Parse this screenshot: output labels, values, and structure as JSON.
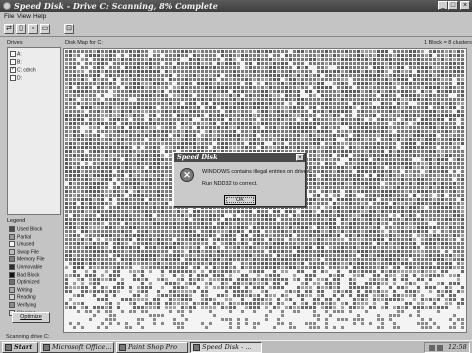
{
  "window": {
    "title": "Speed Disk - Drive C: Scanning, 8% Complete"
  },
  "menu": [
    "File",
    "View",
    "Help"
  ],
  "drives_label": "Drives",
  "drives": [
    {
      "label": "A:",
      "checked": false
    },
    {
      "label": "B:",
      "checked": false
    },
    {
      "label": "C:  cdrch",
      "checked": true
    },
    {
      "label": "D:",
      "checked": false
    }
  ],
  "map_label": "Disk Map for C:",
  "map_scale": "1 Block = 8 clusters",
  "legend": {
    "title": "Legend",
    "items": [
      {
        "label": "Used Block",
        "color": "#4a4a4a"
      },
      {
        "label": "Partial",
        "color": "#9a9a9a"
      },
      {
        "label": "Unused",
        "color": "#f4f4f4"
      },
      {
        "label": "Swap File",
        "color": "#bdbdbd"
      },
      {
        "label": "Memory File",
        "color": "#7e7e7e"
      },
      {
        "label": "Unmovable",
        "color": "#2e2e2e"
      },
      {
        "label": "Bad Block",
        "color": "#111111"
      },
      {
        "label": "Optimized",
        "color": "#6e6e6e"
      },
      {
        "label": "Writing",
        "color": "#a8a8a8"
      },
      {
        "label": "Reading",
        "color": "#d0d0d0"
      },
      {
        "label": "Verifying",
        "color": "#8a8a8a"
      },
      {
        "label": "Clearing",
        "color": "#e0e0e0"
      }
    ]
  },
  "optimize_button": "Optimize",
  "dialog": {
    "title": "Speed Disk",
    "message_line1": "WINDOWS contains illegal entries on drive C",
    "message_line2": "Run NDD32 to correct.",
    "ok": "OK"
  },
  "status": "Scanning drive C:",
  "taskbar": {
    "start": "Start",
    "items": [
      "Microsoft Office...",
      "Paint Shop Pro",
      "Speed Disk - ..."
    ],
    "clock": "12:58"
  },
  "colors": {
    "titlebar": "#4a4a4a",
    "used": "#4a4a4a",
    "unused": "#f4f4f4"
  }
}
